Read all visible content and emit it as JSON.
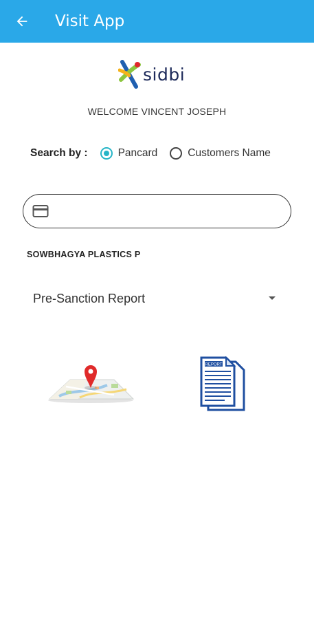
{
  "appbar": {
    "title": "Visit App",
    "back_icon": "arrow-left-icon",
    "background_color": "#2aa8e8"
  },
  "logo": {
    "text": "sidbi"
  },
  "welcome_text": "WELCOME VINCENT JOSEPH",
  "search_by": {
    "label": "Search by :",
    "options": [
      {
        "label": "Pancard",
        "selected": true
      },
      {
        "label": "Customers Name",
        "selected": false
      }
    ],
    "accent_color": "#26b5c7"
  },
  "search_field": {
    "icon": "credit-card-icon",
    "value": "",
    "placeholder": ""
  },
  "company_name": "SOWBHAGYA PLASTICS P",
  "report_type": {
    "selected": "Pre-Sanction Report"
  },
  "actions": {
    "map_icon": "map-pin-icon",
    "report_icon": "report-document-icon",
    "report_label": "REPORT"
  }
}
